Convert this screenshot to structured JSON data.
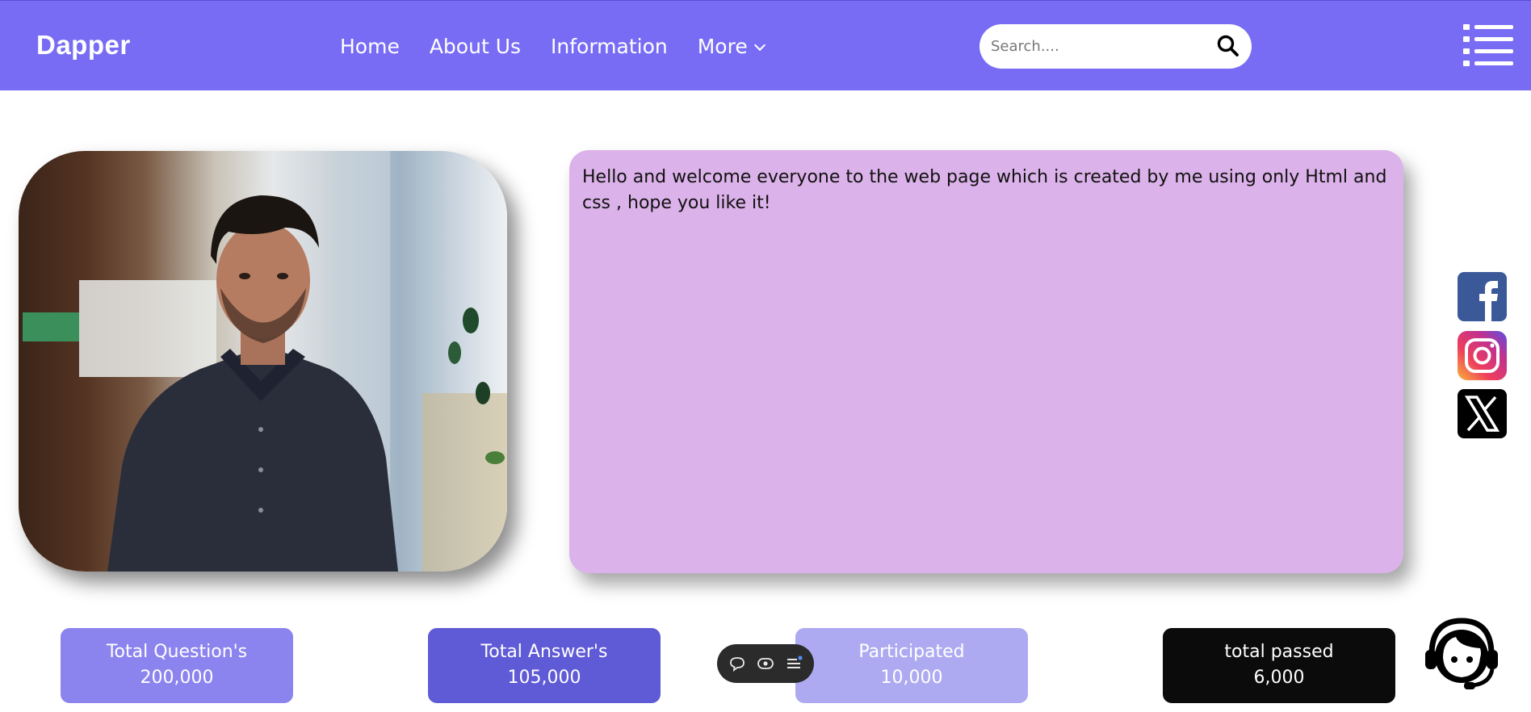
{
  "brand": {
    "name": "Dapper"
  },
  "nav": {
    "links": [
      "Home",
      "About Us",
      "Information"
    ],
    "more_label": "More"
  },
  "search": {
    "placeholder": "Search....",
    "value": ""
  },
  "welcome": {
    "text": "Hello and welcome everyone to the web page which is created by me using only Html and css , hope you like it!"
  },
  "social": [
    "facebook-icon",
    "instagram-icon",
    "x-twitter-icon"
  ],
  "stats": [
    {
      "label": "Total Question's",
      "value": "200,000",
      "color": "#8b84ef"
    },
    {
      "label": "Total Answer's",
      "value": "105,000",
      "color": "#5f5ad6"
    },
    {
      "label": "Participated",
      "value": "10,000",
      "color": "#aeaaf1"
    },
    {
      "label": "total passed",
      "value": "6,000",
      "color": "#0b0b0c"
    }
  ],
  "colors": {
    "navbar": "#786cf5",
    "card": "#dbb2e9"
  }
}
